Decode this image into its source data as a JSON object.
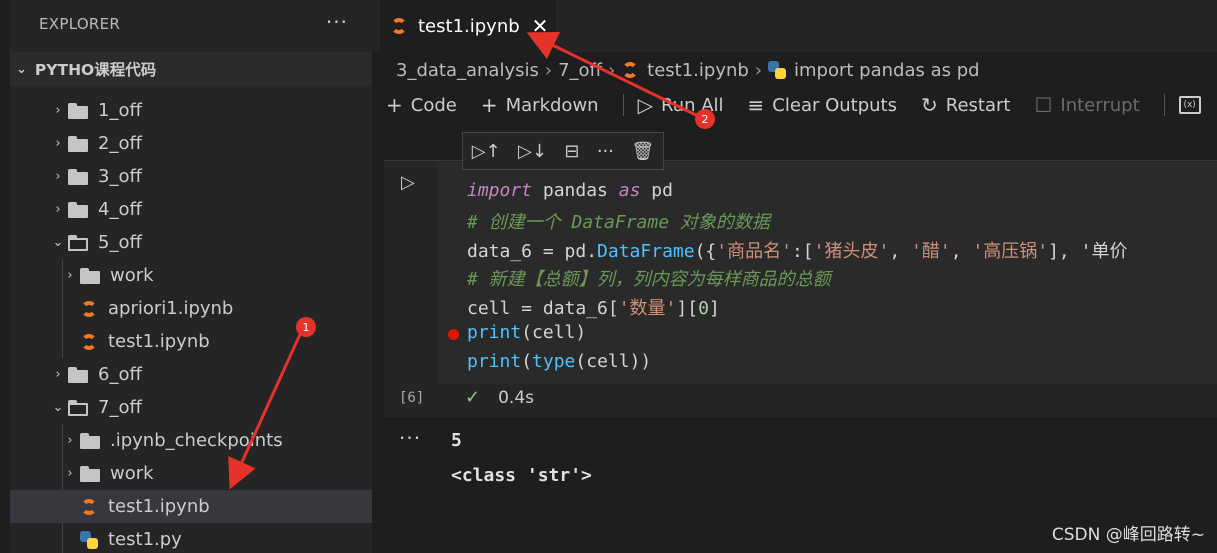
{
  "sidebar": {
    "title": "EXPLORER",
    "more": "···",
    "section": "PYTHO课程代码",
    "tree": [
      {
        "label": "1_off",
        "type": "folder",
        "open": false,
        "depth": 0
      },
      {
        "label": "2_off",
        "type": "folder",
        "open": false,
        "depth": 0
      },
      {
        "label": "3_off",
        "type": "folder",
        "open": false,
        "depth": 0
      },
      {
        "label": "4_off",
        "type": "folder",
        "open": false,
        "depth": 0
      },
      {
        "label": "5_off",
        "type": "folder",
        "open": true,
        "depth": 0
      },
      {
        "label": "work",
        "type": "folder",
        "open": false,
        "depth": 1
      },
      {
        "label": "apriori1.ipynb",
        "type": "jupyter",
        "depth": 1
      },
      {
        "label": "test1.ipynb",
        "type": "jupyter",
        "depth": 1
      },
      {
        "label": "6_off",
        "type": "folder",
        "open": false,
        "depth": 0
      },
      {
        "label": "7_off",
        "type": "folder",
        "open": true,
        "depth": 0
      },
      {
        "label": ".ipynb_checkpoints",
        "type": "folder",
        "open": false,
        "depth": 1
      },
      {
        "label": "work",
        "type": "folder",
        "open": false,
        "depth": 1
      },
      {
        "label": "test1.ipynb",
        "type": "jupyter",
        "depth": 1,
        "selected": true
      },
      {
        "label": "test1.py",
        "type": "python",
        "depth": 1
      }
    ]
  },
  "tab": {
    "label": "test1.ipynb",
    "close": "✕"
  },
  "breadcrumb": {
    "folder1": "3_data_analysis",
    "folder2": "7_off",
    "file": "test1.ipynb",
    "symbol": "import pandas as pd"
  },
  "toolbar": {
    "code": "Code",
    "markdown": "Markdown",
    "run_all": "Run All",
    "clear_outputs": "Clear Outputs",
    "restart": "Restart",
    "interrupt": "Interrupt"
  },
  "cell": {
    "exec_count": "[6]",
    "status_time": "0.4s",
    "code": [
      "import pandas as pd",
      "# 创建一个 DataFrame 对象的数据",
      "data_6 = pd.DataFrame({'商品名':['猪头皮', '醋', '高压锅'], '单价",
      "# 新建【总额】列，列内容为每样商品的总额",
      "cell = data_6['数量'][0]",
      "print(cell)",
      "print(type(cell))"
    ]
  },
  "output": {
    "dots": "···",
    "lines": [
      "5",
      "<class 'str'>"
    ]
  },
  "annotations": {
    "badge1": "1",
    "badge2": "2"
  },
  "watermark": "CSDN @峰回路转~",
  "colors": {
    "accent_red": "#e5332a",
    "jupyter_orange": "#f37726",
    "keyword": "#c586c0",
    "string": "#ce9178",
    "comment": "#6a9955"
  }
}
